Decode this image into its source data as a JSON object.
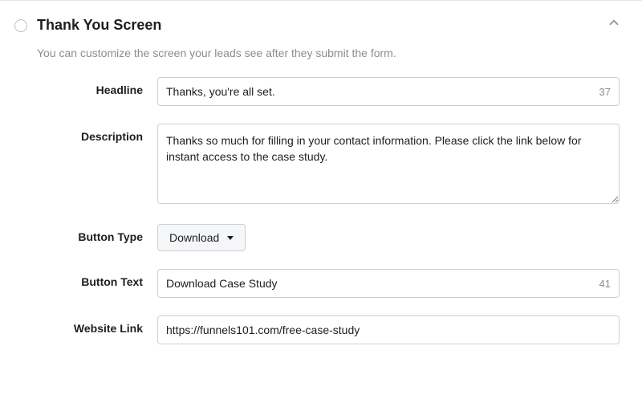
{
  "header": {
    "title": "Thank You Screen",
    "subtitle": "You can customize the screen your leads see after they submit the form."
  },
  "fields": {
    "headline": {
      "label": "Headline",
      "value": "Thanks, you're all set.",
      "counter": "37"
    },
    "description": {
      "label": "Description",
      "value": "Thanks so much for filling in your contact information. Please click the link below for instant access to the case study."
    },
    "button_type": {
      "label": "Button Type",
      "selected": "Download"
    },
    "button_text": {
      "label": "Button Text",
      "value": "Download Case Study",
      "counter": "41"
    },
    "website_link": {
      "label": "Website Link",
      "value": "https://funnels101.com/free-case-study"
    }
  }
}
